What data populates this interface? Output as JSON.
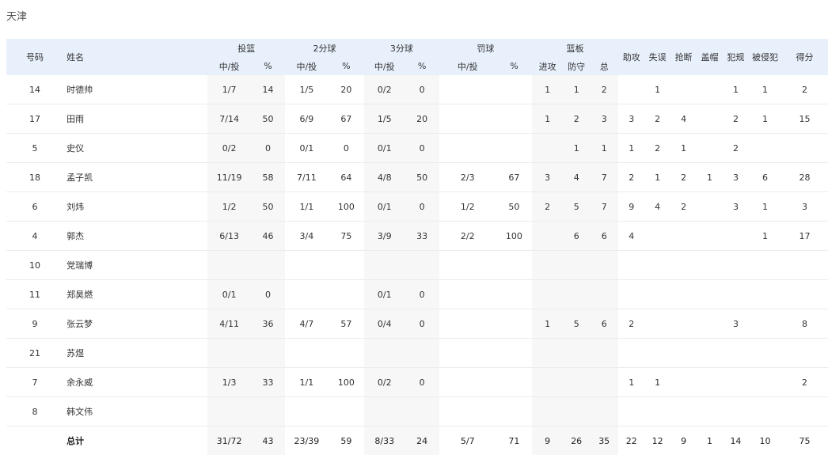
{
  "team": {
    "name": "天津"
  },
  "header": {
    "number": "号码",
    "name": "姓名",
    "fg": "投篮",
    "two": "2分球",
    "three": "3分球",
    "ft": "罚球",
    "reb": "篮板",
    "made_att": "中/投",
    "pct": "%",
    "off": "进攻",
    "def": "防守",
    "tot": "总",
    "ast": "助攻",
    "tov": "失误",
    "stl": "抢断",
    "blk": "盖帽",
    "pf": "犯规",
    "fd": "被侵犯",
    "pts": "得分"
  },
  "players": [
    {
      "num": "14",
      "name": "时德帅",
      "fg": "1/7",
      "fgp": "14",
      "p2": "1/5",
      "p2p": "20",
      "p3": "0/2",
      "p3p": "0",
      "ft": "",
      "ftp": "",
      "or": "1",
      "dr": "1",
      "tr": "2",
      "ast": "",
      "tov": "1",
      "stl": "",
      "blk": "",
      "pf": "1",
      "fd": "1",
      "pts": "2"
    },
    {
      "num": "17",
      "name": "田雨",
      "fg": "7/14",
      "fgp": "50",
      "p2": "6/9",
      "p2p": "67",
      "p3": "1/5",
      "p3p": "20",
      "ft": "",
      "ftp": "",
      "or": "1",
      "dr": "2",
      "tr": "3",
      "ast": "3",
      "tov": "2",
      "stl": "4",
      "blk": "",
      "pf": "2",
      "fd": "1",
      "pts": "15"
    },
    {
      "num": "5",
      "name": "史仪",
      "fg": "0/2",
      "fgp": "0",
      "p2": "0/1",
      "p2p": "0",
      "p3": "0/1",
      "p3p": "0",
      "ft": "",
      "ftp": "",
      "or": "",
      "dr": "1",
      "tr": "1",
      "ast": "1",
      "tov": "2",
      "stl": "1",
      "blk": "",
      "pf": "2",
      "fd": "",
      "pts": ""
    },
    {
      "num": "18",
      "name": "孟子凯",
      "fg": "11/19",
      "fgp": "58",
      "p2": "7/11",
      "p2p": "64",
      "p3": "4/8",
      "p3p": "50",
      "ft": "2/3",
      "ftp": "67",
      "or": "3",
      "dr": "4",
      "tr": "7",
      "ast": "2",
      "tov": "1",
      "stl": "2",
      "blk": "1",
      "pf": "3",
      "fd": "6",
      "pts": "28"
    },
    {
      "num": "6",
      "name": "刘炜",
      "fg": "1/2",
      "fgp": "50",
      "p2": "1/1",
      "p2p": "100",
      "p3": "0/1",
      "p3p": "0",
      "ft": "1/2",
      "ftp": "50",
      "or": "2",
      "dr": "5",
      "tr": "7",
      "ast": "9",
      "tov": "4",
      "stl": "2",
      "blk": "",
      "pf": "3",
      "fd": "1",
      "pts": "3"
    },
    {
      "num": "4",
      "name": "郭杰",
      "fg": "6/13",
      "fgp": "46",
      "p2": "3/4",
      "p2p": "75",
      "p3": "3/9",
      "p3p": "33",
      "ft": "2/2",
      "ftp": "100",
      "or": "",
      "dr": "6",
      "tr": "6",
      "ast": "4",
      "tov": "",
      "stl": "",
      "blk": "",
      "pf": "",
      "fd": "1",
      "pts": "17"
    },
    {
      "num": "10",
      "name": "党瑞博",
      "fg": "",
      "fgp": "",
      "p2": "",
      "p2p": "",
      "p3": "",
      "p3p": "",
      "ft": "",
      "ftp": "",
      "or": "",
      "dr": "",
      "tr": "",
      "ast": "",
      "tov": "",
      "stl": "",
      "blk": "",
      "pf": "",
      "fd": "",
      "pts": ""
    },
    {
      "num": "11",
      "name": "郑昊燃",
      "fg": "0/1",
      "fgp": "0",
      "p2": "",
      "p2p": "",
      "p3": "0/1",
      "p3p": "0",
      "ft": "",
      "ftp": "",
      "or": "",
      "dr": "",
      "tr": "",
      "ast": "",
      "tov": "",
      "stl": "",
      "blk": "",
      "pf": "",
      "fd": "",
      "pts": ""
    },
    {
      "num": "9",
      "name": "张云梦",
      "fg": "4/11",
      "fgp": "36",
      "p2": "4/7",
      "p2p": "57",
      "p3": "0/4",
      "p3p": "0",
      "ft": "",
      "ftp": "",
      "or": "1",
      "dr": "5",
      "tr": "6",
      "ast": "2",
      "tov": "",
      "stl": "",
      "blk": "",
      "pf": "3",
      "fd": "",
      "pts": "8"
    },
    {
      "num": "21",
      "name": "苏煜",
      "fg": "",
      "fgp": "",
      "p2": "",
      "p2p": "",
      "p3": "",
      "p3p": "",
      "ft": "",
      "ftp": "",
      "or": "",
      "dr": "",
      "tr": "",
      "ast": "",
      "tov": "",
      "stl": "",
      "blk": "",
      "pf": "",
      "fd": "",
      "pts": ""
    },
    {
      "num": "7",
      "name": "余永威",
      "fg": "1/3",
      "fgp": "33",
      "p2": "1/1",
      "p2p": "100",
      "p3": "0/2",
      "p3p": "0",
      "ft": "",
      "ftp": "",
      "or": "",
      "dr": "",
      "tr": "",
      "ast": "1",
      "tov": "1",
      "stl": "",
      "blk": "",
      "pf": "",
      "fd": "",
      "pts": "2"
    },
    {
      "num": "8",
      "name": "韩文伟",
      "fg": "",
      "fgp": "",
      "p2": "",
      "p2p": "",
      "p3": "",
      "p3p": "",
      "ft": "",
      "ftp": "",
      "or": "",
      "dr": "",
      "tr": "",
      "ast": "",
      "tov": "",
      "stl": "",
      "blk": "",
      "pf": "",
      "fd": "",
      "pts": ""
    }
  ],
  "total": {
    "label": "总计",
    "fg": "31/72",
    "fgp": "43",
    "p2": "23/39",
    "p2p": "59",
    "p3": "8/33",
    "p3p": "24",
    "ft": "5/7",
    "ftp": "71",
    "or": "9",
    "dr": "26",
    "tr": "35",
    "ast": "22",
    "tov": "12",
    "stl": "9",
    "blk": "1",
    "pf": "14",
    "fd": "10",
    "pts": "75"
  }
}
